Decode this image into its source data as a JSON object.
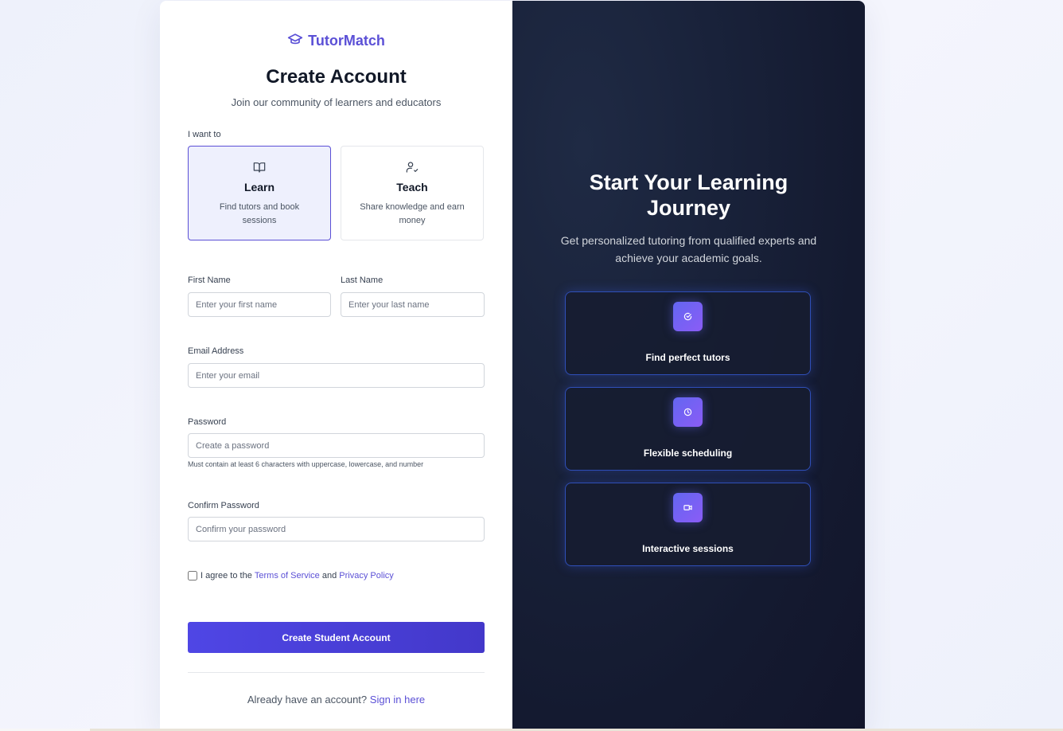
{
  "brand": {
    "name": "TutorMatch",
    "icon": "graduation-cap-icon",
    "color": "#5b50d6"
  },
  "header": {
    "title": "Create Account",
    "subtitle": "Join our community of learners and educators"
  },
  "role": {
    "label": "I want to",
    "options": [
      {
        "title": "Learn",
        "description": "Find tutors and book sessions",
        "icon": "book-open-icon",
        "selected": true
      },
      {
        "title": "Teach",
        "description": "Share knowledge and earn money",
        "icon": "user-check-icon",
        "selected": false
      }
    ]
  },
  "form": {
    "first_name": {
      "label": "First Name",
      "placeholder": "Enter your first name",
      "value": ""
    },
    "last_name": {
      "label": "Last Name",
      "placeholder": "Enter your last name",
      "value": ""
    },
    "email": {
      "label": "Email Address",
      "placeholder": "Enter your email",
      "value": ""
    },
    "password": {
      "label": "Password",
      "placeholder": "Create a password",
      "value": "",
      "hint": "Must contain at least 6 characters with uppercase, lowercase, and number"
    },
    "confirm_password": {
      "label": "Confirm Password",
      "placeholder": "Confirm your password",
      "value": ""
    },
    "agree": {
      "prefix": "I agree to the",
      "terms": "Terms of Service",
      "and": "and",
      "privacy": "Privacy Policy",
      "checked": false
    },
    "submit_label": "Create Student Account"
  },
  "footer": {
    "prompt": "Already have an account?",
    "link": "Sign in here"
  },
  "promo": {
    "title_line1": "Start Your Learning",
    "title_line2": "Journey",
    "subtitle": "Get personalized tutoring from qualified experts and achieve your academic goals.",
    "features": [
      {
        "label": "Find perfect tutors",
        "icon": "check-circle-icon"
      },
      {
        "label": "Flexible scheduling",
        "icon": "clock-icon"
      },
      {
        "label": "Interactive sessions",
        "icon": "video-icon"
      }
    ]
  },
  "colors": {
    "accent": "#4f46e5",
    "panel_dark": "#141a30",
    "feature_border": "#2f4fb8"
  }
}
